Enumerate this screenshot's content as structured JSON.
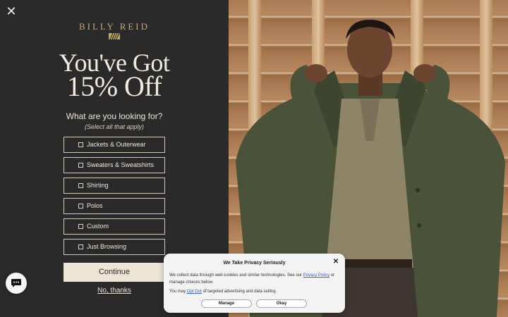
{
  "modal": {
    "brand": "BILLY REID",
    "headline_line1": "You've Got",
    "headline_line2": "15% Off",
    "question": "What are you looking for?",
    "hint": "(Select all that apply)",
    "options": [
      {
        "label": "Jackets & Outerwear",
        "checked": false
      },
      {
        "label": "Sweaters & Sweatshirts",
        "checked": false
      },
      {
        "label": "Shirting",
        "checked": false
      },
      {
        "label": "Polos",
        "checked": false
      },
      {
        "label": "Custom",
        "checked": false
      },
      {
        "label": "Just Browsing",
        "checked": false
      }
    ],
    "continue_label": "Continue",
    "no_thanks_label": "No, thanks",
    "close_icon": "close-icon",
    "colors": {
      "panel": "#2a2a2a",
      "gold": "#c9a866",
      "button": "#ece5d6"
    }
  },
  "privacy": {
    "title": "We Take Privacy Seriously",
    "text_before_link": "We collect data through web cookies and similar technologies. See our",
    "privacy_link": "Privacy Policy",
    "text_after_link": "or manage choices below.",
    "line2_before": "You may",
    "opt_out_link": "Opt Out",
    "line2_after": "of targeted advertising and data selling.",
    "manage_label": "Manage",
    "okay_label": "Okay"
  },
  "chat_icon": "chat-icon"
}
